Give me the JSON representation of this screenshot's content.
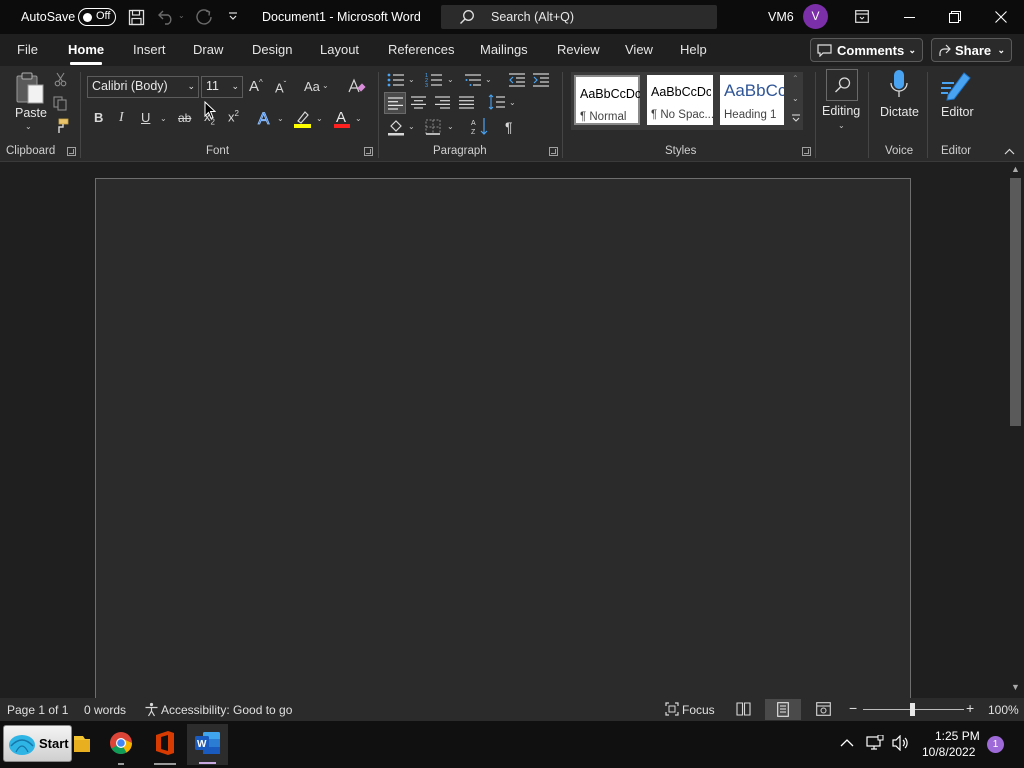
{
  "titlebar": {
    "autosave_label": "AutoSave",
    "autosave_state": "Off",
    "document_title": "Document1  -  Microsoft Word",
    "search_placeholder": "Search (Alt+Q)",
    "user_name": "VM6",
    "user_initial": "V"
  },
  "tabs": [
    "File",
    "Home",
    "Insert",
    "Draw",
    "Design",
    "Layout",
    "References",
    "Mailings",
    "Review",
    "View",
    "Help"
  ],
  "active_tab": "Home",
  "comments_label": "Comments",
  "share_label": "Share",
  "ribbon": {
    "clipboard": {
      "paste_label": "Paste",
      "group_label": "Clipboard"
    },
    "font": {
      "font_name": "Calibri (Body)",
      "font_size": "11",
      "change_case": "Aa",
      "group_label": "Font"
    },
    "paragraph": {
      "group_label": "Paragraph"
    },
    "styles": {
      "group_label": "Styles",
      "items": [
        {
          "sample": "AaBbCcDc",
          "name": "¶ Normal"
        },
        {
          "sample": "AaBbCcDc",
          "name": "¶ No Spac..."
        },
        {
          "sample": "AaBbCc",
          "name": "Heading 1"
        }
      ]
    },
    "editing": {
      "label": "Editing"
    },
    "voice": {
      "dictate_label": "Dictate",
      "group_label": "Voice"
    },
    "editor": {
      "label": "Editor",
      "group_label": "Editor"
    }
  },
  "statusbar": {
    "page": "Page 1 of 1",
    "words": "0 words",
    "accessibility": "Accessibility: Good to go",
    "focus": "Focus",
    "zoom": "100%",
    "zoom_minus": "−",
    "zoom_plus": "+"
  },
  "taskbar": {
    "start_label": "Start",
    "time": "1:25 PM",
    "date": "10/8/2022",
    "notification_count": "1"
  },
  "colors": {
    "avatar": "#7b2fa8",
    "highlight_color": "#ffff00",
    "font_color": "#ff2020",
    "word_blue": "#185abd",
    "dictate_blue": "#4aa3f0"
  }
}
